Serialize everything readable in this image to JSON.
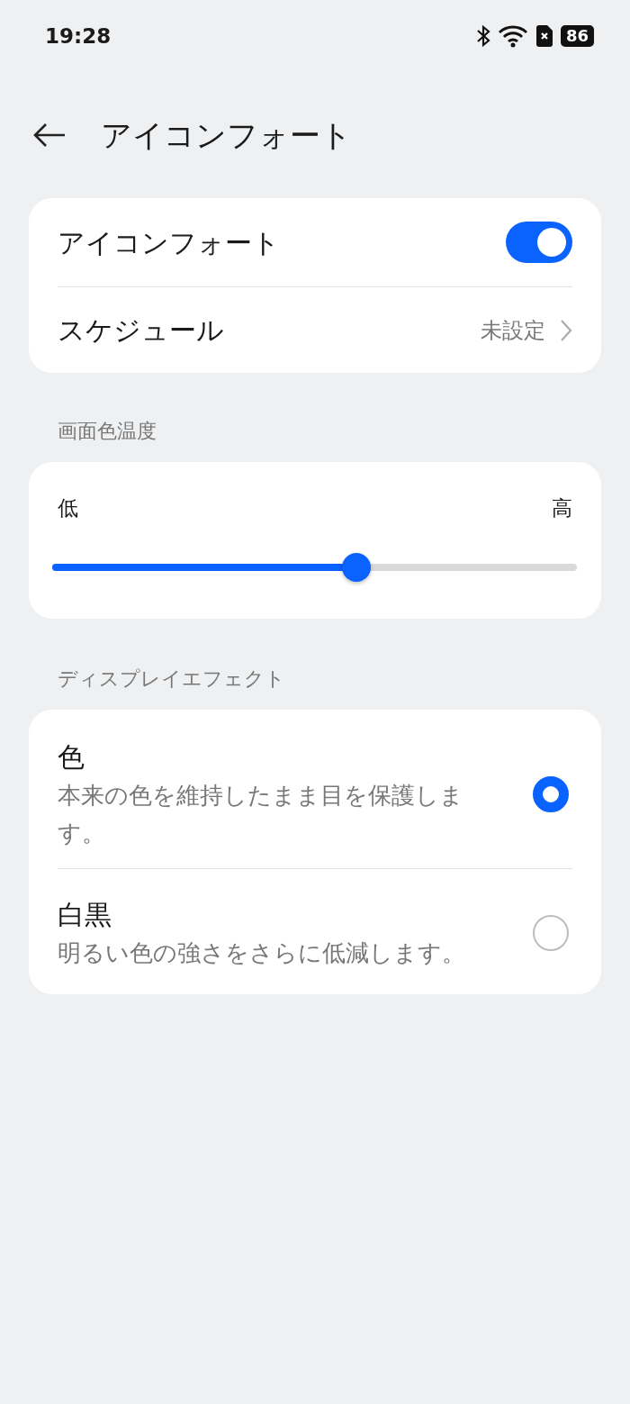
{
  "status_bar": {
    "time": "19:28",
    "battery": "86"
  },
  "header": {
    "title": "アイコンフォート"
  },
  "main_card": [
    {
      "kind": "toggle",
      "label": "アイコンフォート",
      "on": true
    },
    {
      "kind": "link",
      "label": "スケジュール",
      "value": "未設定"
    }
  ],
  "temperature": {
    "heading": "画面色温度",
    "low_label": "低",
    "high_label": "高",
    "level": 0.58
  },
  "display_effect": {
    "heading": "ディスプレイエフェクト",
    "options": [
      {
        "title": "色",
        "description": "本来の色を維持したまま目を保護します。",
        "selected": true
      },
      {
        "title": "白黒",
        "description": "明るい色の強さをさらに低減します。",
        "selected": false
      }
    ]
  }
}
